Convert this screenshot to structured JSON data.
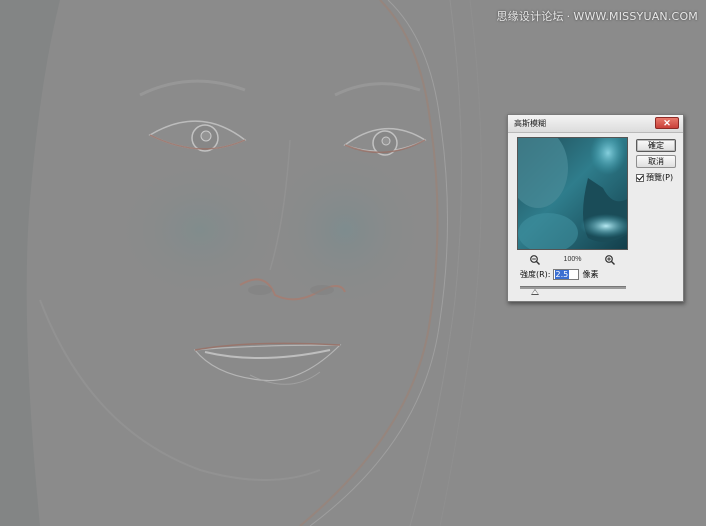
{
  "watermark": {
    "site_cn": "思缘设计论坛",
    "site_url": "WWW.MISSYUAN.COM"
  },
  "dialog": {
    "title": "高斯模糊",
    "close_label": "✕",
    "ok_label": "確定",
    "cancel_label": "取消",
    "preview_checkbox": {
      "label": "預覽(P)",
      "checked": true
    },
    "zoom": {
      "value": "100%",
      "zoom_out_icon": "zoom-out-magnifier-icon",
      "zoom_in_icon": "zoom-in-magnifier-icon"
    },
    "radius": {
      "label": "強度(R):",
      "value": "2.5",
      "unit": "像素"
    }
  },
  "colors": {
    "canvas_gray": "#8b8b8b",
    "dialog_bg": "#ececec",
    "preview_cyan": "#3fa6b8",
    "selection_blue": "#3b6fd2",
    "close_red": "#c9403a"
  }
}
